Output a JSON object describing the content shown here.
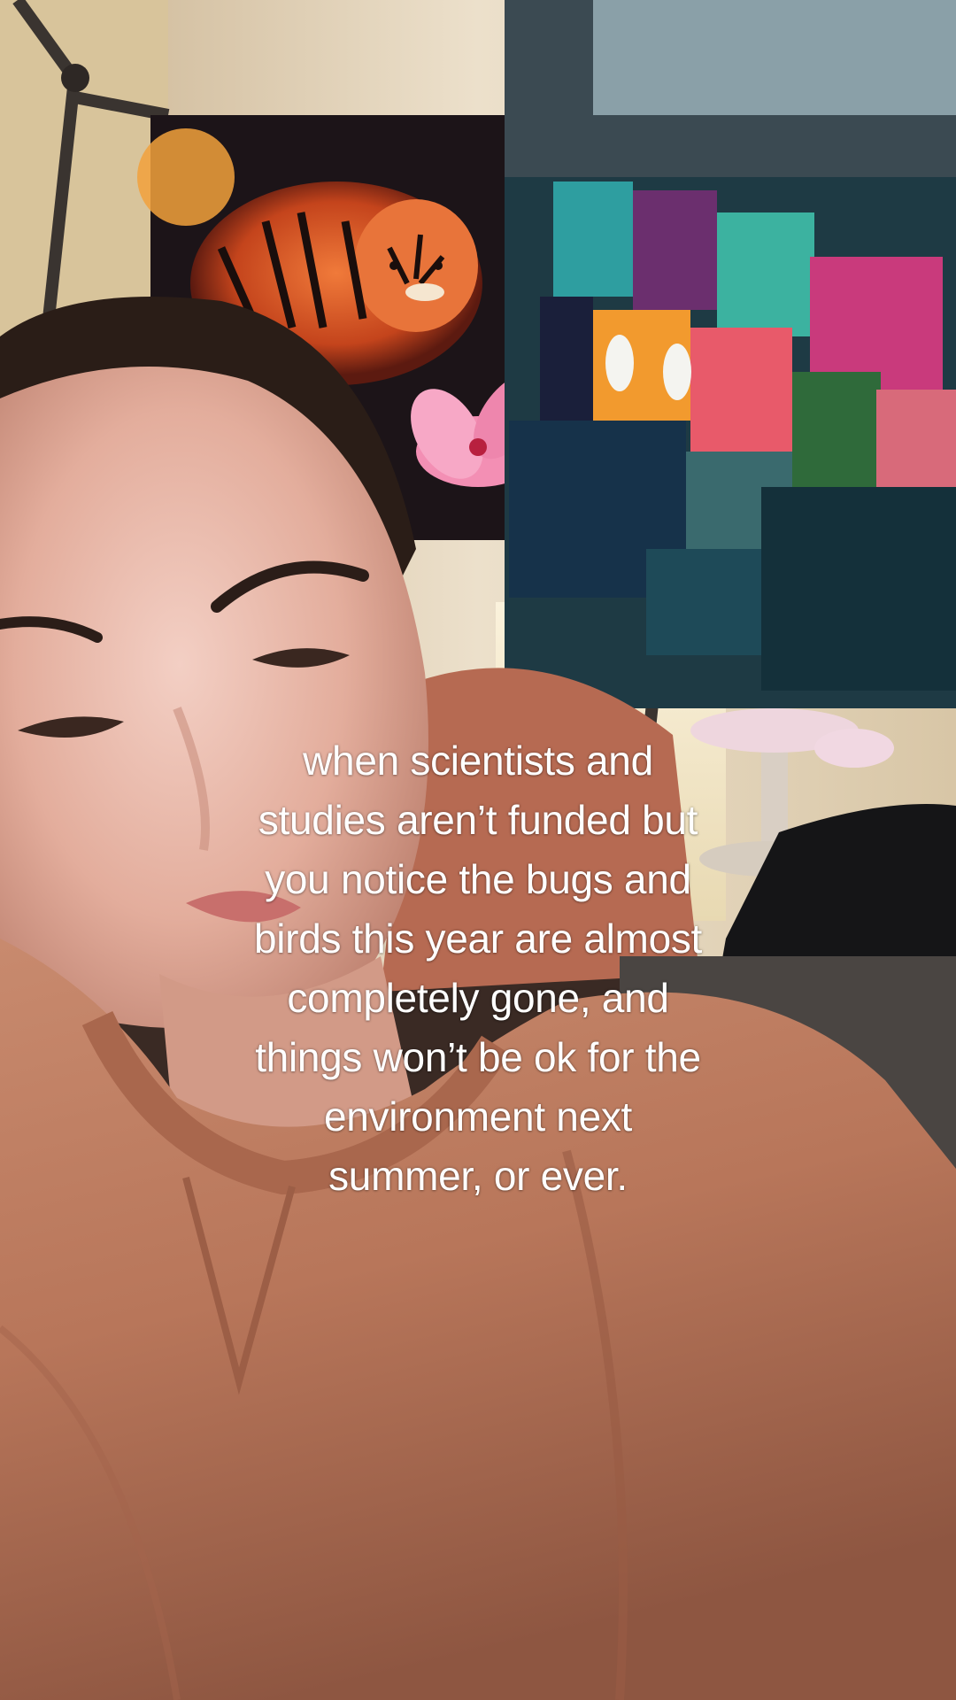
{
  "video": {
    "caption_lines": [
      "when scientists and",
      "studies aren’t funded but",
      "you notice the bugs and",
      "birds this year are almost",
      "completely gone, and",
      "things won’t be ok for the",
      "environment next",
      "summer, or ever."
    ]
  },
  "colors": {
    "caption_text": "#ffffff",
    "sweatshirt": "#b8765a",
    "wall": "#e6d3b8",
    "tapestry_dark": "#1c1418",
    "quilt_dark": "#1e3a44"
  }
}
